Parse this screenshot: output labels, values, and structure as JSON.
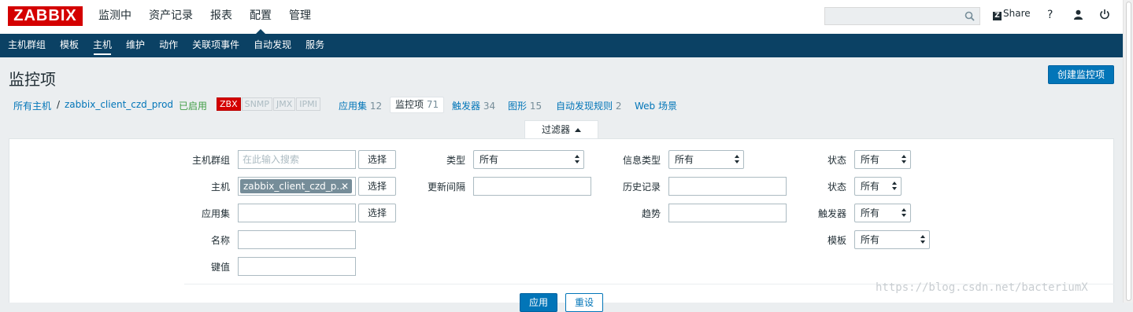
{
  "brand": {
    "logo_text": "ZABBIX"
  },
  "main_menu": [
    "监测中",
    "资产记录",
    "报表",
    "配置",
    "管理"
  ],
  "main_menu_active": "配置",
  "top_tools": {
    "search_value": "",
    "share_label": "Share",
    "help_label": "?"
  },
  "sub_menu": [
    "主机群组",
    "模板",
    "主机",
    "维护",
    "动作",
    "关联项事件",
    "自动发现",
    "服务"
  ],
  "sub_menu_active": "主机",
  "page": {
    "title": "监控项",
    "create_button": "创建监控项"
  },
  "breadcrumb": {
    "all_hosts": "所有主机",
    "separator": "/",
    "host": "zabbix_client_czd_prod",
    "status": "已启用",
    "availability": [
      "ZBX",
      "SNMP",
      "JMX",
      "IPMI"
    ],
    "tabs": [
      {
        "label": "应用集",
        "count": "12"
      },
      {
        "label": "监控项",
        "count": "71"
      },
      {
        "label": "触发器",
        "count": "34"
      },
      {
        "label": "图形",
        "count": "15"
      },
      {
        "label": "自动发现规则",
        "count": "2"
      },
      {
        "label": "Web 场景",
        "count": ""
      }
    ]
  },
  "filter": {
    "tab_label": "过滤器",
    "host_group_label": "主机群组",
    "host_group_placeholder": "在此输入搜索",
    "select_label": "选择",
    "host_label": "主机",
    "host_chip": "zabbix_client_czd_p...",
    "app_label": "应用集",
    "name_label": "名称",
    "key_label": "键值",
    "type_label": "类型",
    "type_value": "所有",
    "interval_label": "更新间隔",
    "info_type_label": "信息类型",
    "info_type_value": "所有",
    "history_label": "历史记录",
    "trends_label": "趋势",
    "state_label": "状态",
    "state_value": "所有",
    "status_label": "状态",
    "status_value": "所有",
    "triggers_label": "触发器",
    "triggers_value": "所有",
    "template_label": "模板",
    "template_value": "所有",
    "apply_label": "应用",
    "reset_label": "重设"
  },
  "watermark": "https://blog.csdn.net/bacteriumX"
}
